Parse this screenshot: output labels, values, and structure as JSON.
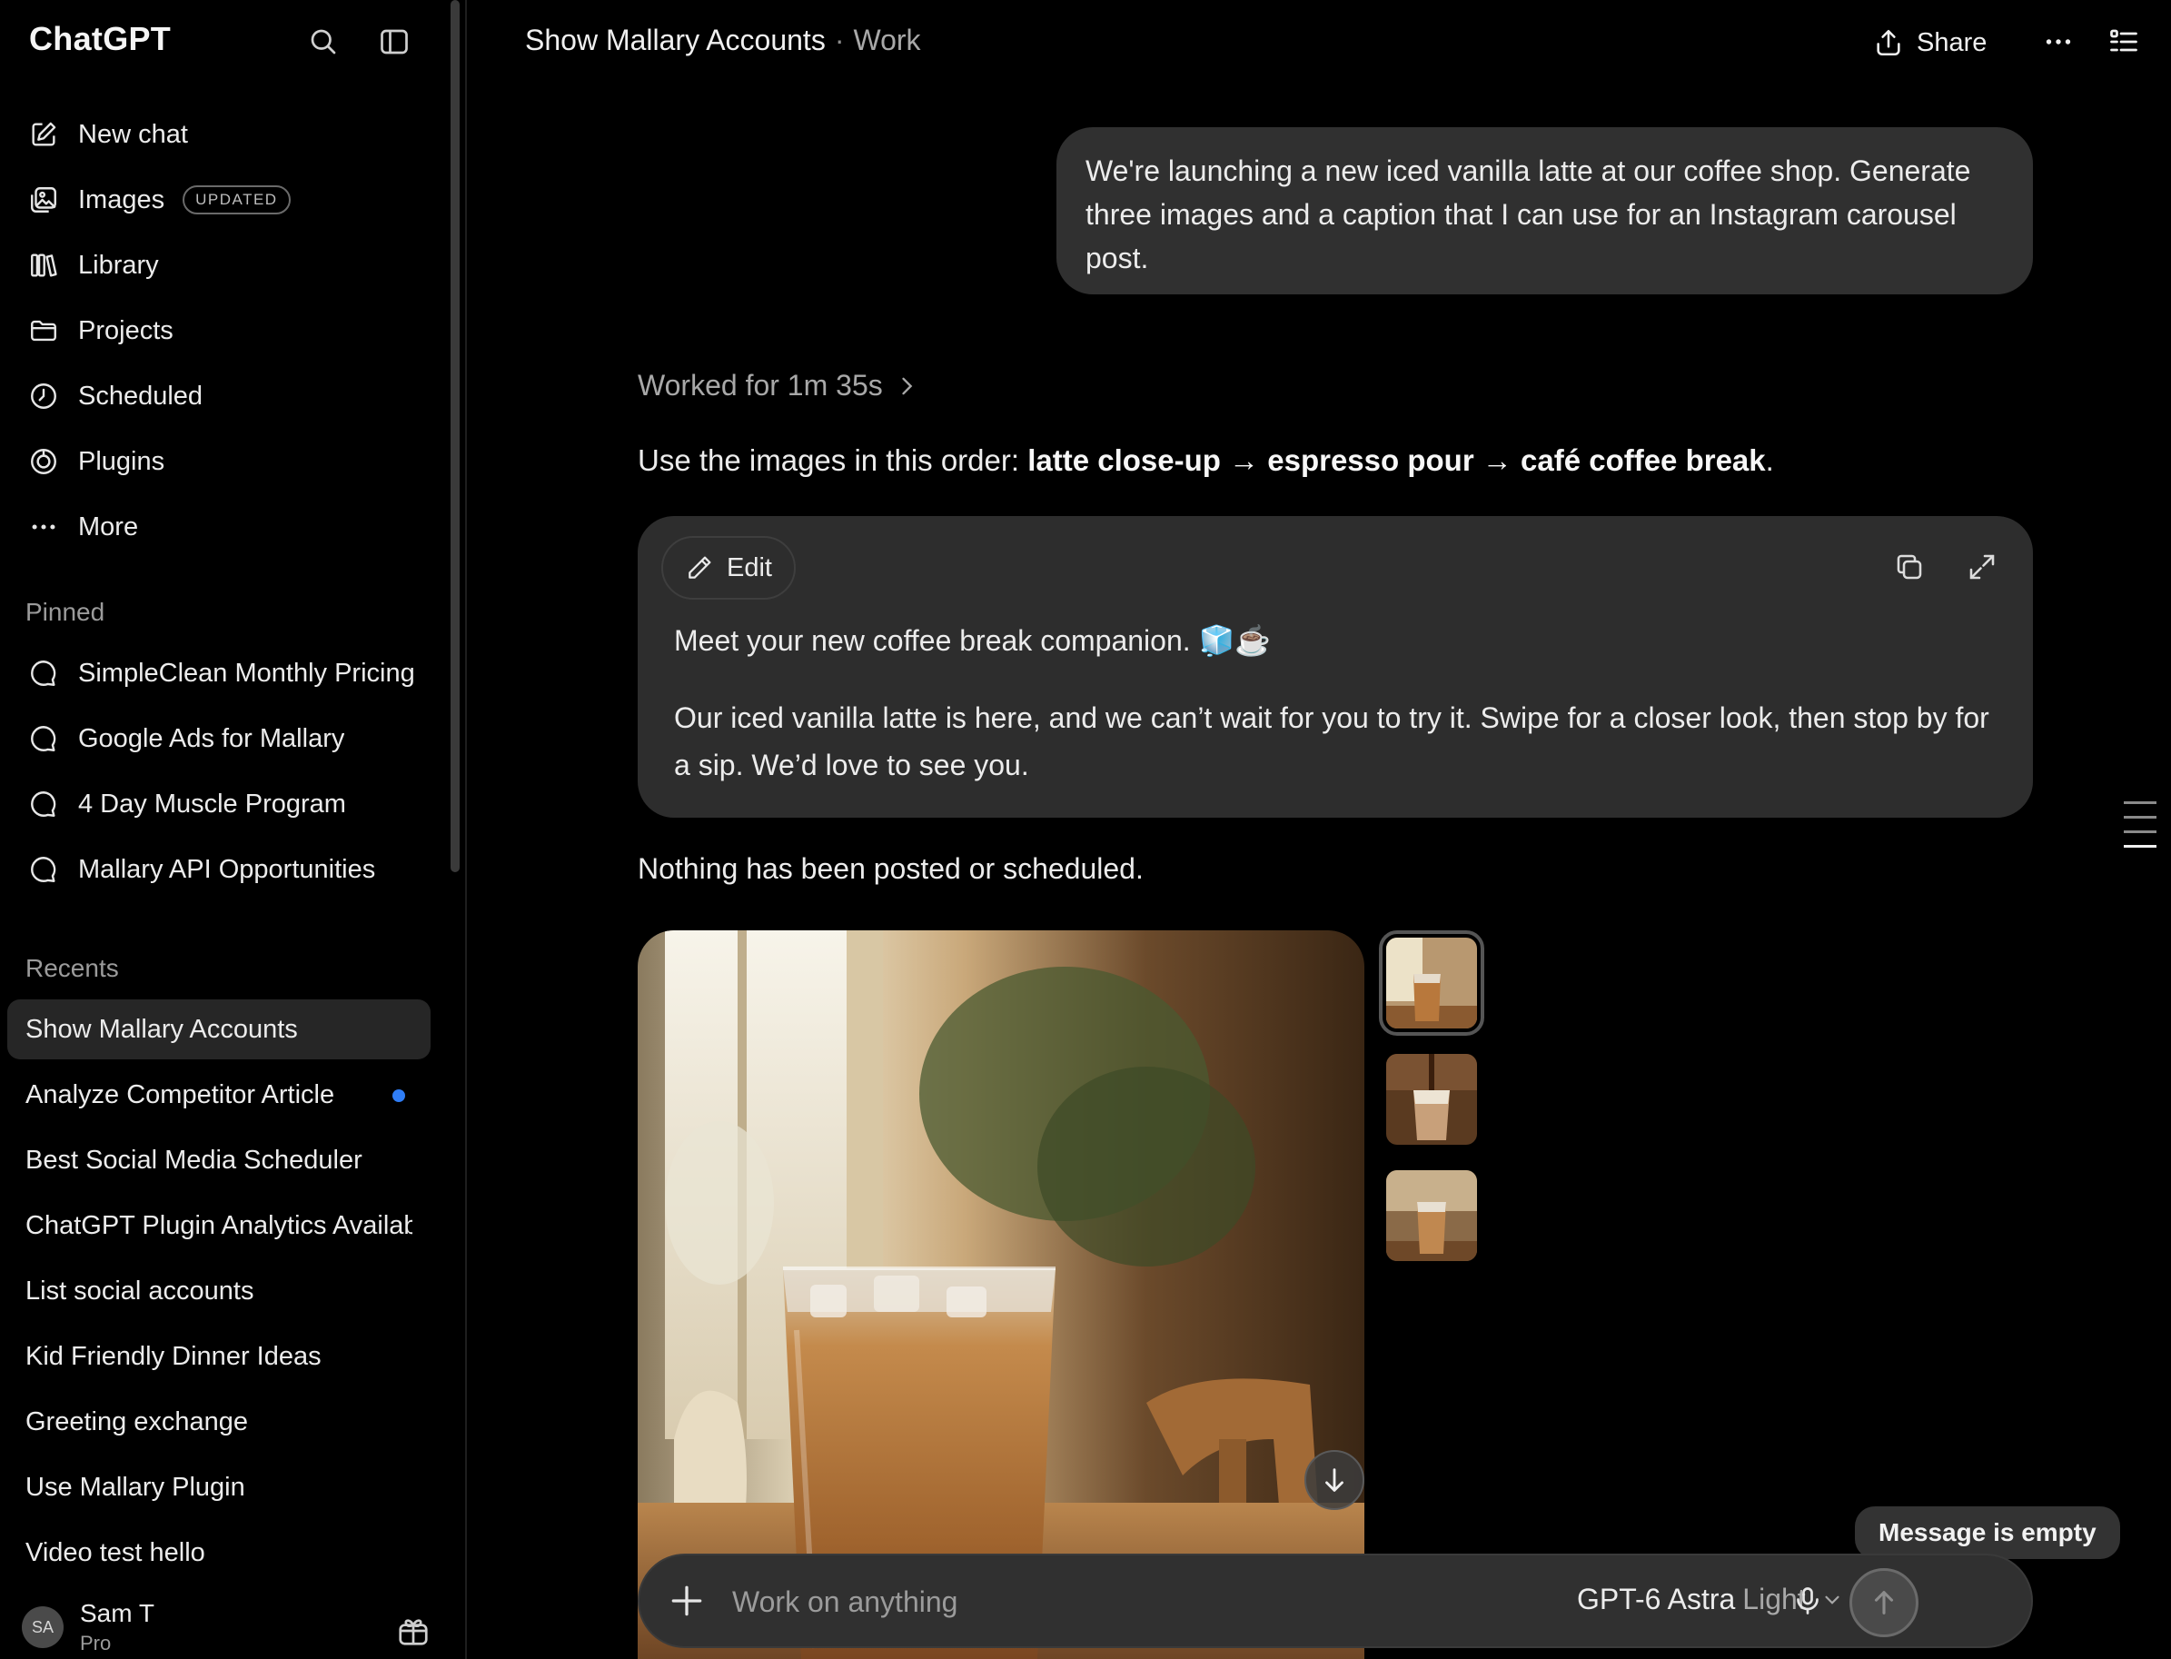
{
  "sidebar": {
    "brand": "ChatGPT",
    "nav": [
      {
        "label": "New chat",
        "icon": "edit-icon"
      },
      {
        "label": "Images",
        "icon": "images-icon",
        "badge": "UPDATED"
      },
      {
        "label": "Library",
        "icon": "library-icon"
      },
      {
        "label": "Projects",
        "icon": "folder-icon"
      },
      {
        "label": "Scheduled",
        "icon": "clock-icon"
      },
      {
        "label": "Plugins",
        "icon": "plugin-icon"
      },
      {
        "label": "More",
        "icon": "dots-icon"
      }
    ],
    "pinned_label": "Pinned",
    "pinned": [
      "SimpleClean Monthly Pricing",
      "Google Ads for Mallary",
      "4 Day Muscle Program",
      "Mallary API Opportunities"
    ],
    "recents_label": "Recents",
    "recents": [
      "Show Mallary Accounts",
      "Analyze Competitor Article",
      "Best Social Media Scheduler",
      "ChatGPT Plugin Analytics Available",
      "List social accounts",
      "Kid Friendly Dinner Ideas",
      "Greeting exchange",
      "Use Mallary Plugin",
      "Video test hello"
    ],
    "user": {
      "initials": "SA",
      "name": "Sam T",
      "plan": "Pro"
    }
  },
  "header": {
    "title": "Show Mallary Accounts",
    "separator": "·",
    "project": "Work",
    "share_label": "Share"
  },
  "conversation": {
    "user_message": "We're launching a new iced vanilla latte at our coffee shop. Generate three images and a caption that I can use for an Instagram carousel post.",
    "worked_for": "Worked for 1m 35s",
    "instruction_prefix": "Use the images in this order: ",
    "instruction_order": "latte close-up → espresso pour → café coffee break",
    "instruction_suffix": ".",
    "caption_card": {
      "edit_label": "Edit",
      "line1": "Meet your new coffee break companion. 🧊☕",
      "line2": "Our iced vanilla latte is here, and we can’t wait for you to try it. Swipe for a closer look, then stop by for a sip. We’d love to see you."
    },
    "status": "Nothing has been posted or scheduled."
  },
  "composer": {
    "placeholder": "Work on anything",
    "model": "GPT-6 Astra",
    "mode": "Light",
    "tooltip": "Message is empty"
  },
  "colors": {
    "background": "#000000",
    "bubble": "#303030",
    "card": "#2d2d2d",
    "unread_dot": "#2f7df6"
  }
}
